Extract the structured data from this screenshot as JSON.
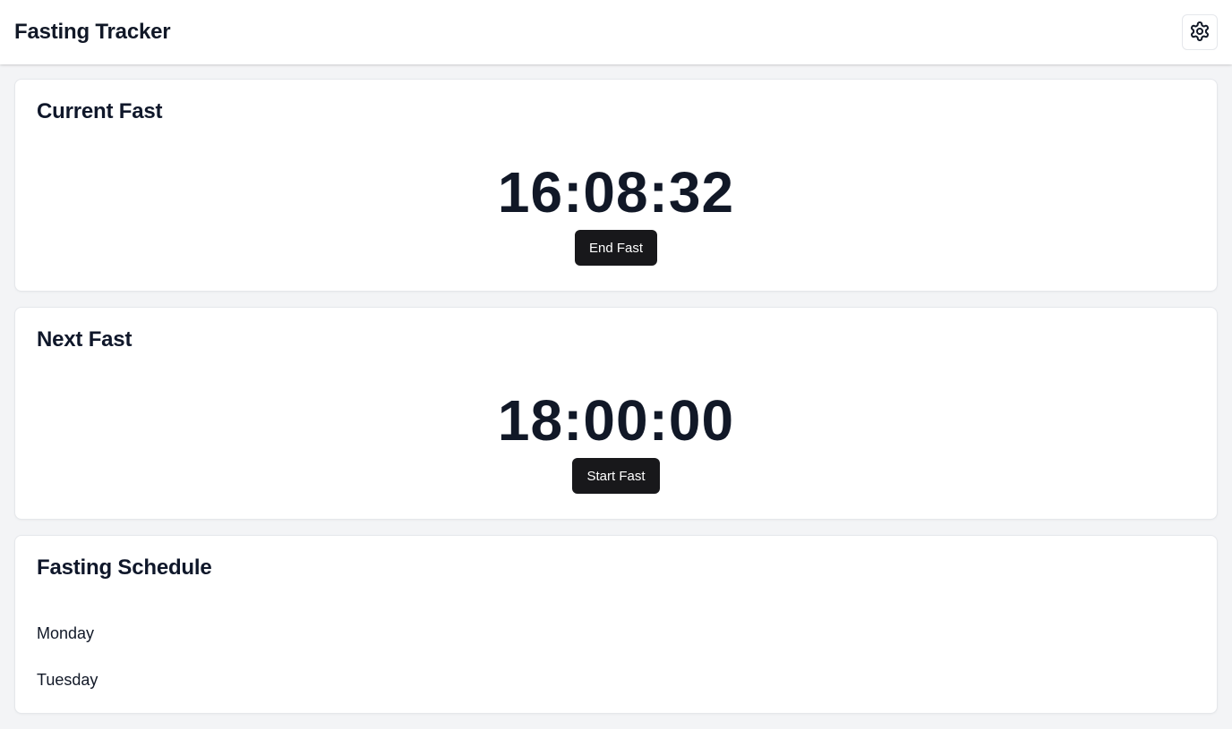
{
  "header": {
    "title": "Fasting Tracker",
    "settings_icon": "gear-icon"
  },
  "current_fast": {
    "title": "Current Fast",
    "timer": "16:08:32",
    "button_label": "End Fast"
  },
  "next_fast": {
    "title": "Next Fast",
    "timer": "18:00:00",
    "button_label": "Start Fast"
  },
  "schedule": {
    "title": "Fasting Schedule",
    "days": [
      {
        "label": "Monday"
      },
      {
        "label": "Tuesday"
      }
    ]
  },
  "colors": {
    "background": "#f3f4f6",
    "card": "#ffffff",
    "button": "#18181b",
    "text": "#111827"
  }
}
